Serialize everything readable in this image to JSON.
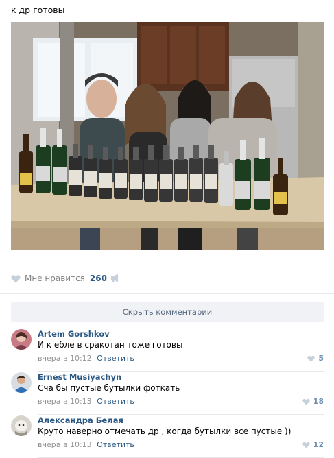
{
  "post": {
    "text": "к др готовы"
  },
  "actions": {
    "like_label": "Мне нравится",
    "like_count": "260"
  },
  "comments_toggle": "Скрыть комментарии",
  "comments": [
    {
      "author": "Artem Gorshkov",
      "text": "И к ебле в сракотан тоже готовы",
      "time": "вчера в 10:12",
      "reply": "Ответить",
      "likes": "5"
    },
    {
      "author": "Ernest Musiyachyn",
      "text": "Сча бы пустые бутылки фоткать",
      "time": "вчера в 10:13",
      "reply": "Ответить",
      "likes": "18"
    },
    {
      "author": "Александра Белая",
      "text": "Круто наверно отмечать др , когда бутылки все пустые ))",
      "time": "вчера в 10:13",
      "reply": "Ответить",
      "likes": "12"
    }
  ],
  "icons": {
    "like": "heart-icon",
    "share": "megaphone-icon"
  },
  "colors": {
    "link": "#2a5885",
    "muted": "#828282",
    "button_bg": "#f0f2f5"
  }
}
